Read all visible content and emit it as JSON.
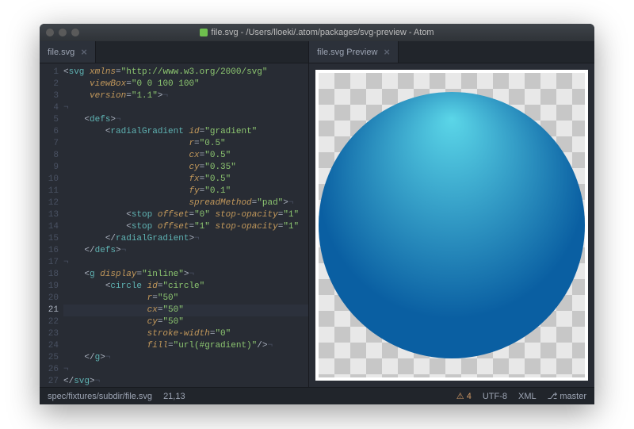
{
  "window": {
    "title": "file.svg - /Users/lloeki/.atom/packages/svg-preview - Atom"
  },
  "tabs": {
    "left": {
      "label": "file.svg",
      "close": "×"
    },
    "right": {
      "label": "file.svg Preview",
      "close": "×"
    }
  },
  "gutter": [
    "1",
    "2",
    "3",
    "4",
    "5",
    "6",
    "7",
    "8",
    "9",
    "10",
    "11",
    "12",
    "13",
    "14",
    "15",
    "16",
    "17",
    "18",
    "19",
    "20",
    "21",
    "22",
    "23",
    "24",
    "25",
    "26",
    "27"
  ],
  "cursor_line": 21,
  "code": [
    [
      [
        "t-br",
        "<"
      ],
      [
        "t-tag",
        "svg"
      ],
      [
        "t-br",
        " "
      ],
      [
        "t-attr",
        "xmlns"
      ],
      [
        "t-op",
        "="
      ],
      [
        "t-str",
        "\"http://www.w3.org/2000/svg\""
      ]
    ],
    [
      [
        "",
        "     "
      ],
      [
        "t-attr",
        "viewBox"
      ],
      [
        "t-op",
        "="
      ],
      [
        "t-str",
        "\"0 0 100 100\""
      ]
    ],
    [
      [
        "",
        "     "
      ],
      [
        "t-attr",
        "version"
      ],
      [
        "t-op",
        "="
      ],
      [
        "t-str",
        "\"1.1\""
      ],
      [
        "t-br",
        ">"
      ],
      [
        "t-inv",
        "¬"
      ]
    ],
    [
      [
        "t-inv",
        "¬"
      ]
    ],
    [
      [
        "",
        "    "
      ],
      [
        "t-br",
        "<"
      ],
      [
        "t-tag",
        "defs"
      ],
      [
        "t-br",
        ">"
      ],
      [
        "t-inv",
        "¬"
      ]
    ],
    [
      [
        "",
        "        "
      ],
      [
        "t-br",
        "<"
      ],
      [
        "t-tag",
        "radialGradient"
      ],
      [
        "t-br",
        " "
      ],
      [
        "t-attr",
        "id"
      ],
      [
        "t-op",
        "="
      ],
      [
        "t-str",
        "\"gradient\""
      ]
    ],
    [
      [
        "",
        "                        "
      ],
      [
        "t-attr",
        "r"
      ],
      [
        "t-op",
        "="
      ],
      [
        "t-str",
        "\"0.5\""
      ]
    ],
    [
      [
        "",
        "                        "
      ],
      [
        "t-attr",
        "cx"
      ],
      [
        "t-op",
        "="
      ],
      [
        "t-str",
        "\"0.5\""
      ]
    ],
    [
      [
        "",
        "                        "
      ],
      [
        "t-attr",
        "cy"
      ],
      [
        "t-op",
        "="
      ],
      [
        "t-str",
        "\"0.35\""
      ]
    ],
    [
      [
        "",
        "                        "
      ],
      [
        "t-attr",
        "fx"
      ],
      [
        "t-op",
        "="
      ],
      [
        "t-str",
        "\"0.5\""
      ]
    ],
    [
      [
        "",
        "                        "
      ],
      [
        "t-attr",
        "fy"
      ],
      [
        "t-op",
        "="
      ],
      [
        "t-str",
        "\"0.1\""
      ]
    ],
    [
      [
        "",
        "                        "
      ],
      [
        "t-attr",
        "spreadMethod"
      ],
      [
        "t-op",
        "="
      ],
      [
        "t-str",
        "\"pad\""
      ],
      [
        "t-br",
        ">"
      ],
      [
        "t-inv",
        "¬"
      ]
    ],
    [
      [
        "",
        "            "
      ],
      [
        "t-br",
        "<"
      ],
      [
        "t-tag",
        "stop"
      ],
      [
        "t-br",
        " "
      ],
      [
        "t-attr",
        "offset"
      ],
      [
        "t-op",
        "="
      ],
      [
        "t-str",
        "\"0\""
      ],
      [
        "t-br",
        " "
      ],
      [
        "t-attr",
        "stop-opacity"
      ],
      [
        "t-op",
        "="
      ],
      [
        "t-str",
        "\"1\""
      ]
    ],
    [
      [
        "",
        "            "
      ],
      [
        "t-br",
        "<"
      ],
      [
        "t-tag",
        "stop"
      ],
      [
        "t-br",
        " "
      ],
      [
        "t-attr",
        "offset"
      ],
      [
        "t-op",
        "="
      ],
      [
        "t-str",
        "\"1\""
      ],
      [
        "t-br",
        " "
      ],
      [
        "t-attr",
        "stop-opacity"
      ],
      [
        "t-op",
        "="
      ],
      [
        "t-str",
        "\"1\""
      ]
    ],
    [
      [
        "",
        "        "
      ],
      [
        "t-br",
        "</"
      ],
      [
        "t-tag",
        "radialGradient"
      ],
      [
        "t-br",
        ">"
      ],
      [
        "t-inv",
        "¬"
      ]
    ],
    [
      [
        "",
        "    "
      ],
      [
        "t-br",
        "</"
      ],
      [
        "t-tag",
        "defs"
      ],
      [
        "t-br",
        ">"
      ],
      [
        "t-inv",
        "¬"
      ]
    ],
    [
      [
        "t-inv",
        "¬"
      ]
    ],
    [
      [
        "",
        "    "
      ],
      [
        "t-br",
        "<"
      ],
      [
        "t-tag",
        "g"
      ],
      [
        "t-br",
        " "
      ],
      [
        "t-attr",
        "display"
      ],
      [
        "t-op",
        "="
      ],
      [
        "t-str",
        "\"inline\""
      ],
      [
        "t-br",
        ">"
      ],
      [
        "t-inv",
        "¬"
      ]
    ],
    [
      [
        "",
        "        "
      ],
      [
        "t-br",
        "<"
      ],
      [
        "t-tag",
        "circle"
      ],
      [
        "t-br",
        " "
      ],
      [
        "t-attr",
        "id"
      ],
      [
        "t-op",
        "="
      ],
      [
        "t-str",
        "\"circle\""
      ]
    ],
    [
      [
        "",
        "                "
      ],
      [
        "t-attr",
        "r"
      ],
      [
        "t-op",
        "="
      ],
      [
        "t-str",
        "\"50\""
      ]
    ],
    [
      [
        "",
        "                "
      ],
      [
        "t-attr",
        "cx"
      ],
      [
        "t-op",
        "="
      ],
      [
        "t-str",
        "\"50\""
      ]
    ],
    [
      [
        "",
        "                "
      ],
      [
        "t-attr",
        "cy"
      ],
      [
        "t-op",
        "="
      ],
      [
        "t-str",
        "\"50\""
      ]
    ],
    [
      [
        "",
        "                "
      ],
      [
        "t-attr",
        "stroke-width"
      ],
      [
        "t-op",
        "="
      ],
      [
        "t-str",
        "\"0\""
      ]
    ],
    [
      [
        "",
        "                "
      ],
      [
        "t-attr",
        "fill"
      ],
      [
        "t-op",
        "="
      ],
      [
        "t-str",
        "\"url(#gradient)\""
      ],
      [
        "t-br",
        "/>"
      ],
      [
        "t-inv",
        "¬"
      ]
    ],
    [
      [
        "",
        "    "
      ],
      [
        "t-br",
        "</"
      ],
      [
        "t-tag",
        "g"
      ],
      [
        "t-br",
        ">"
      ],
      [
        "t-inv",
        "¬"
      ]
    ],
    [
      [
        "t-inv",
        "¬"
      ]
    ],
    [
      [
        "t-br",
        "</"
      ],
      [
        "t-tag",
        "svg"
      ],
      [
        "t-br",
        ">"
      ],
      [
        "t-inv",
        "¬"
      ]
    ]
  ],
  "status": {
    "path": "spec/fixtures/subdir/file.svg",
    "pos": "21,13",
    "warnings": "4",
    "encoding": "UTF-8",
    "grammar": "XML",
    "branch": "master"
  },
  "preview_svg": {
    "gradient": {
      "r": "0.5",
      "cx": "0.5",
      "cy": "0.35",
      "fx": "0.5",
      "fy": "0.1",
      "stops": [
        {
          "offset": "0",
          "color": "#5bd6e8"
        },
        {
          "offset": "1",
          "color": "#0a5fa2"
        }
      ]
    },
    "circle": {
      "r": "50",
      "cx": "50",
      "cy": "50"
    }
  }
}
